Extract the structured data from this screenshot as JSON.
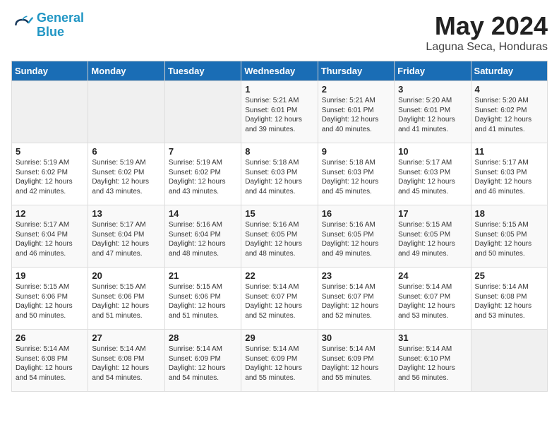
{
  "header": {
    "logo_general": "General",
    "logo_blue": "Blue",
    "month_year": "May 2024",
    "location": "Laguna Seca, Honduras"
  },
  "days_of_week": [
    "Sunday",
    "Monday",
    "Tuesday",
    "Wednesday",
    "Thursday",
    "Friday",
    "Saturday"
  ],
  "weeks": [
    [
      {
        "num": "",
        "info": ""
      },
      {
        "num": "",
        "info": ""
      },
      {
        "num": "",
        "info": ""
      },
      {
        "num": "1",
        "info": "Sunrise: 5:21 AM\nSunset: 6:01 PM\nDaylight: 12 hours\nand 39 minutes."
      },
      {
        "num": "2",
        "info": "Sunrise: 5:21 AM\nSunset: 6:01 PM\nDaylight: 12 hours\nand 40 minutes."
      },
      {
        "num": "3",
        "info": "Sunrise: 5:20 AM\nSunset: 6:01 PM\nDaylight: 12 hours\nand 41 minutes."
      },
      {
        "num": "4",
        "info": "Sunrise: 5:20 AM\nSunset: 6:02 PM\nDaylight: 12 hours\nand 41 minutes."
      }
    ],
    [
      {
        "num": "5",
        "info": "Sunrise: 5:19 AM\nSunset: 6:02 PM\nDaylight: 12 hours\nand 42 minutes."
      },
      {
        "num": "6",
        "info": "Sunrise: 5:19 AM\nSunset: 6:02 PM\nDaylight: 12 hours\nand 43 minutes."
      },
      {
        "num": "7",
        "info": "Sunrise: 5:19 AM\nSunset: 6:02 PM\nDaylight: 12 hours\nand 43 minutes."
      },
      {
        "num": "8",
        "info": "Sunrise: 5:18 AM\nSunset: 6:03 PM\nDaylight: 12 hours\nand 44 minutes."
      },
      {
        "num": "9",
        "info": "Sunrise: 5:18 AM\nSunset: 6:03 PM\nDaylight: 12 hours\nand 45 minutes."
      },
      {
        "num": "10",
        "info": "Sunrise: 5:17 AM\nSunset: 6:03 PM\nDaylight: 12 hours\nand 45 minutes."
      },
      {
        "num": "11",
        "info": "Sunrise: 5:17 AM\nSunset: 6:03 PM\nDaylight: 12 hours\nand 46 minutes."
      }
    ],
    [
      {
        "num": "12",
        "info": "Sunrise: 5:17 AM\nSunset: 6:04 PM\nDaylight: 12 hours\nand 46 minutes."
      },
      {
        "num": "13",
        "info": "Sunrise: 5:17 AM\nSunset: 6:04 PM\nDaylight: 12 hours\nand 47 minutes."
      },
      {
        "num": "14",
        "info": "Sunrise: 5:16 AM\nSunset: 6:04 PM\nDaylight: 12 hours\nand 48 minutes."
      },
      {
        "num": "15",
        "info": "Sunrise: 5:16 AM\nSunset: 6:05 PM\nDaylight: 12 hours\nand 48 minutes."
      },
      {
        "num": "16",
        "info": "Sunrise: 5:16 AM\nSunset: 6:05 PM\nDaylight: 12 hours\nand 49 minutes."
      },
      {
        "num": "17",
        "info": "Sunrise: 5:15 AM\nSunset: 6:05 PM\nDaylight: 12 hours\nand 49 minutes."
      },
      {
        "num": "18",
        "info": "Sunrise: 5:15 AM\nSunset: 6:05 PM\nDaylight: 12 hours\nand 50 minutes."
      }
    ],
    [
      {
        "num": "19",
        "info": "Sunrise: 5:15 AM\nSunset: 6:06 PM\nDaylight: 12 hours\nand 50 minutes."
      },
      {
        "num": "20",
        "info": "Sunrise: 5:15 AM\nSunset: 6:06 PM\nDaylight: 12 hours\nand 51 minutes."
      },
      {
        "num": "21",
        "info": "Sunrise: 5:15 AM\nSunset: 6:06 PM\nDaylight: 12 hours\nand 51 minutes."
      },
      {
        "num": "22",
        "info": "Sunrise: 5:14 AM\nSunset: 6:07 PM\nDaylight: 12 hours\nand 52 minutes."
      },
      {
        "num": "23",
        "info": "Sunrise: 5:14 AM\nSunset: 6:07 PM\nDaylight: 12 hours\nand 52 minutes."
      },
      {
        "num": "24",
        "info": "Sunrise: 5:14 AM\nSunset: 6:07 PM\nDaylight: 12 hours\nand 53 minutes."
      },
      {
        "num": "25",
        "info": "Sunrise: 5:14 AM\nSunset: 6:08 PM\nDaylight: 12 hours\nand 53 minutes."
      }
    ],
    [
      {
        "num": "26",
        "info": "Sunrise: 5:14 AM\nSunset: 6:08 PM\nDaylight: 12 hours\nand 54 minutes."
      },
      {
        "num": "27",
        "info": "Sunrise: 5:14 AM\nSunset: 6:08 PM\nDaylight: 12 hours\nand 54 minutes."
      },
      {
        "num": "28",
        "info": "Sunrise: 5:14 AM\nSunset: 6:09 PM\nDaylight: 12 hours\nand 54 minutes."
      },
      {
        "num": "29",
        "info": "Sunrise: 5:14 AM\nSunset: 6:09 PM\nDaylight: 12 hours\nand 55 minutes."
      },
      {
        "num": "30",
        "info": "Sunrise: 5:14 AM\nSunset: 6:09 PM\nDaylight: 12 hours\nand 55 minutes."
      },
      {
        "num": "31",
        "info": "Sunrise: 5:14 AM\nSunset: 6:10 PM\nDaylight: 12 hours\nand 56 minutes."
      },
      {
        "num": "",
        "info": ""
      }
    ]
  ]
}
